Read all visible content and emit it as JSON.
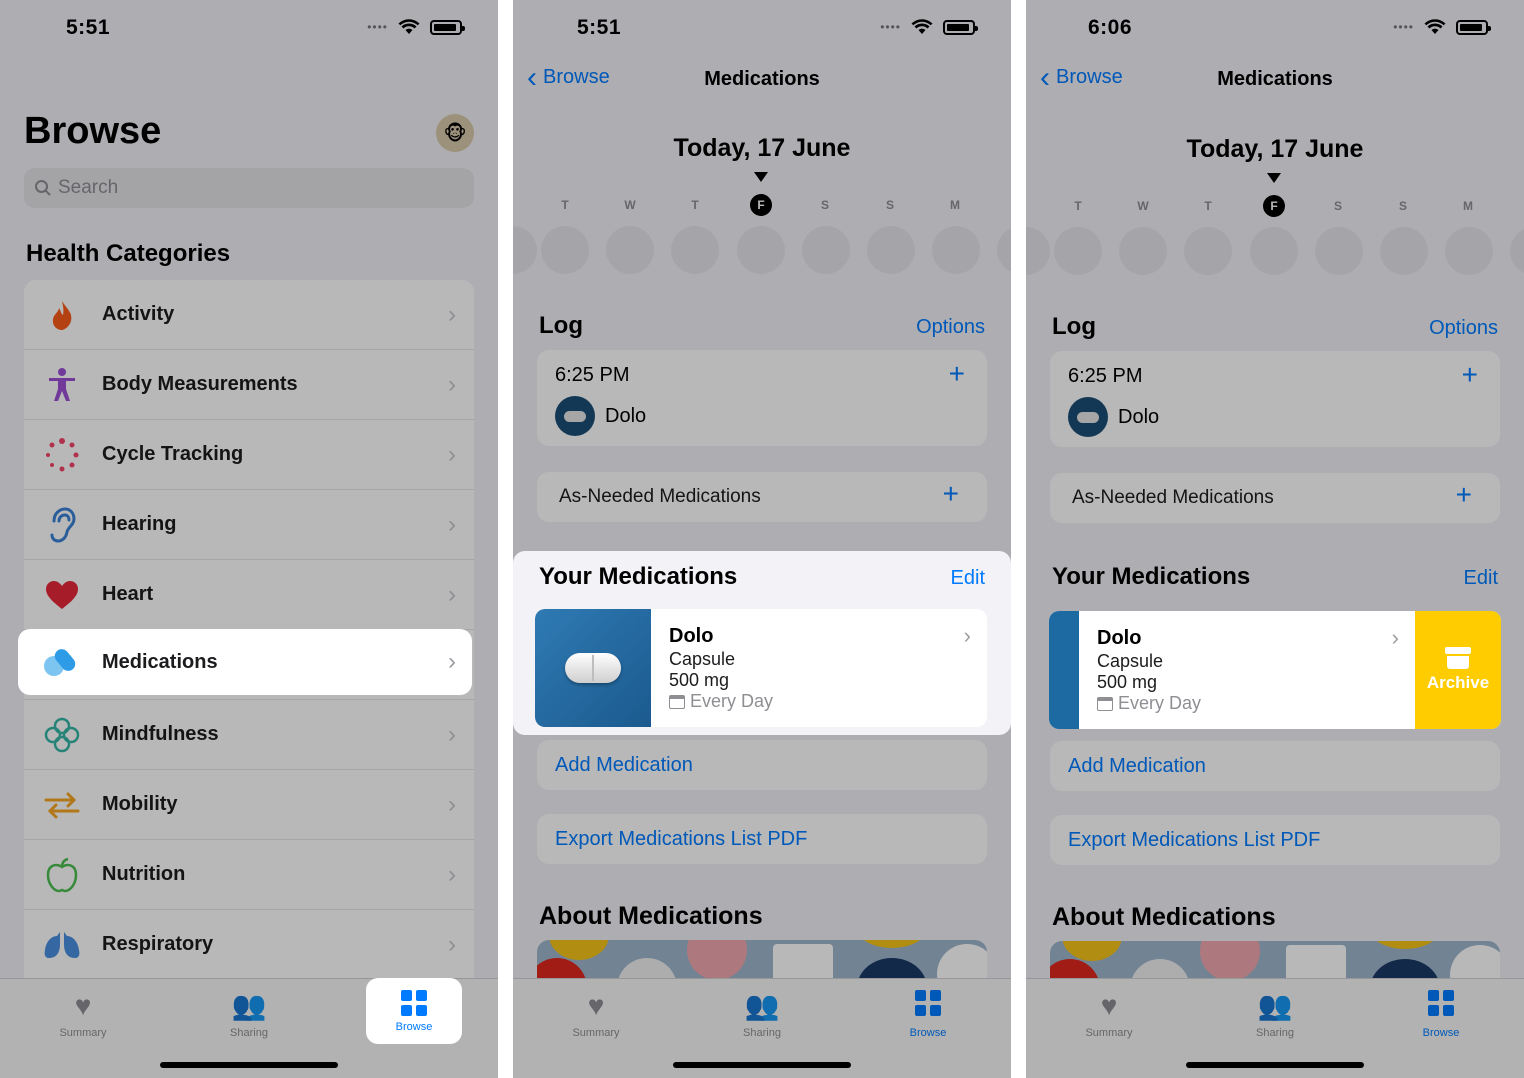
{
  "screen1": {
    "time": "5:51",
    "title": "Browse",
    "search_placeholder": "Search",
    "section": "Health Categories",
    "categories": [
      {
        "label": "Activity",
        "icon": "flame-icon"
      },
      {
        "label": "Body Measurements",
        "icon": "person-icon"
      },
      {
        "label": "Cycle Tracking",
        "icon": "cycle-icon"
      },
      {
        "label": "Hearing",
        "icon": "ear-icon"
      },
      {
        "label": "Heart",
        "icon": "heart-icon"
      },
      {
        "label": "Medications",
        "icon": "pills-icon"
      },
      {
        "label": "Mindfulness",
        "icon": "flower-icon"
      },
      {
        "label": "Mobility",
        "icon": "arrows-icon"
      },
      {
        "label": "Nutrition",
        "icon": "apple-icon"
      },
      {
        "label": "Respiratory",
        "icon": "lungs-icon"
      }
    ],
    "tabs": {
      "summary": "Summary",
      "sharing": "Sharing",
      "browse": "Browse"
    }
  },
  "screen2": {
    "time": "5:51",
    "back": "Browse",
    "nav_title": "Medications",
    "date": "Today, 17 June",
    "week_days": [
      "T",
      "W",
      "T",
      "F",
      "S",
      "S",
      "M"
    ],
    "log_title": "Log",
    "options": "Options",
    "log_time": "6:25 PM",
    "log_med": "Dolo",
    "as_needed": "As-Needed Medications",
    "your_meds": "Your Medications",
    "edit": "Edit",
    "med": {
      "name": "Dolo",
      "form": "Capsule",
      "dose": "500 mg",
      "schedule": "Every Day"
    },
    "add": "Add Medication",
    "export": "Export Medications List PDF",
    "about": "About Medications",
    "tabs": {
      "summary": "Summary",
      "sharing": "Sharing",
      "browse": "Browse"
    }
  },
  "screen3": {
    "time": "6:06",
    "back": "Browse",
    "nav_title": "Medications",
    "date": "Today, 17 June",
    "week_days": [
      "T",
      "W",
      "T",
      "F",
      "S",
      "S",
      "M"
    ],
    "log_title": "Log",
    "options": "Options",
    "log_time": "6:25 PM",
    "log_med": "Dolo",
    "as_needed": "As-Needed Medications",
    "your_meds": "Your Medications",
    "edit": "Edit",
    "med": {
      "name": "Dolo",
      "form": "Capsule",
      "dose": "500 mg",
      "schedule": "Every Day"
    },
    "archive": "Archive",
    "add": "Add Medication",
    "export": "Export Medications List PDF",
    "about": "About Medications",
    "tabs": {
      "summary": "Summary",
      "sharing": "Sharing",
      "browse": "Browse"
    }
  },
  "colors": {
    "accent": "#007aff",
    "archive": "#ffcc00",
    "capsule_bg": "#1d6aa3"
  }
}
